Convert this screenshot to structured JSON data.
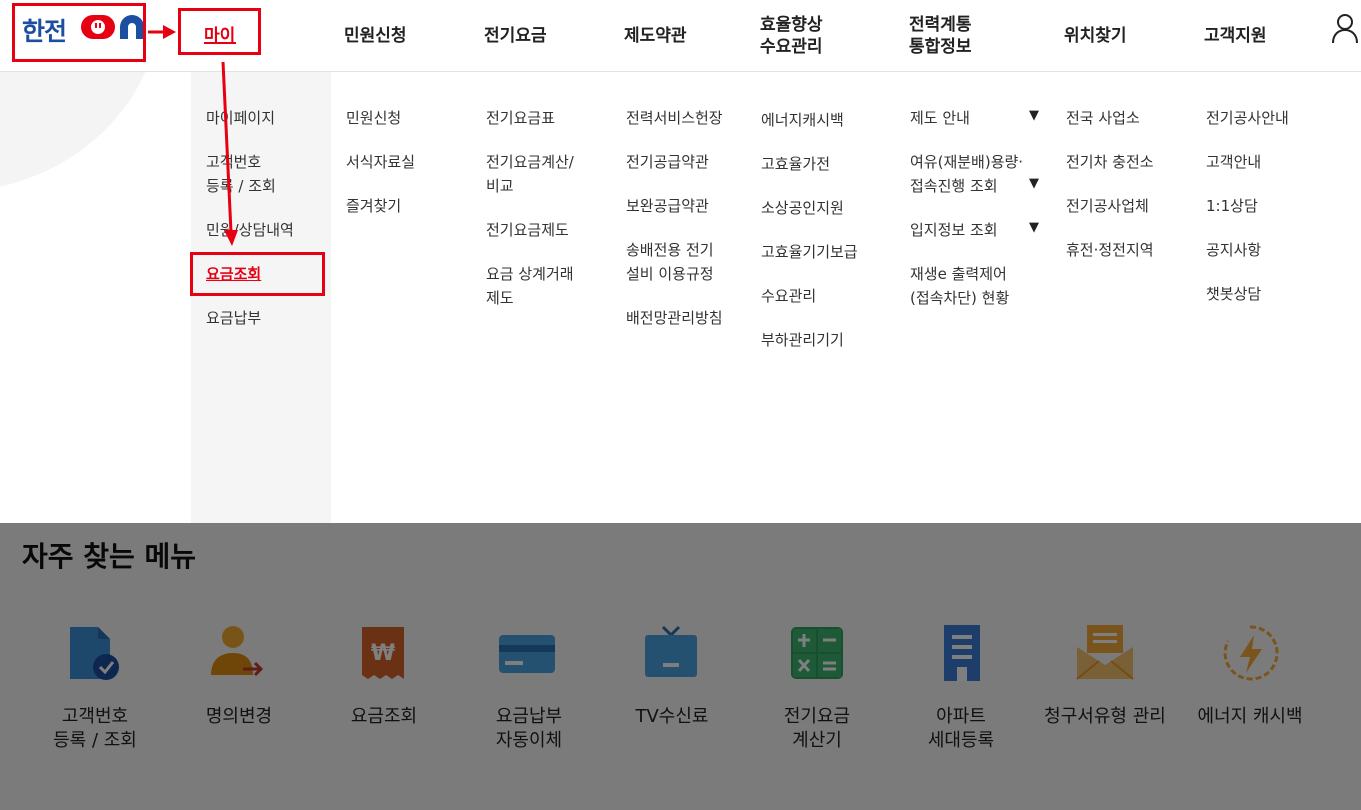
{
  "header": {
    "logo_text": "한전",
    "logo_on_text": "ON",
    "nav": {
      "mine": "마이",
      "civil": "민원신청",
      "bill": "전기요금",
      "terms": "제도약관",
      "efficiency_line1": "효율향상",
      "efficiency_line2": "수요관리",
      "grid_line1": "전력계통",
      "grid_line2": "통합정보",
      "location": "위치찾기",
      "support": "고객지원"
    }
  },
  "dropdown": {
    "mine": [
      "마이페이지",
      "고객번호",
      "등록 / 조회",
      "민원/상담내역",
      "요금조회",
      "요금납부"
    ],
    "civil": [
      "민원신청",
      "서식자료실",
      "즐겨찾기"
    ],
    "bill": [
      "전기요금표",
      "전기요금계산/",
      "비교",
      "전기요금제도",
      "요금 상계거래",
      "제도"
    ],
    "terms": [
      "전력서비스헌장",
      "전기공급약관",
      "보완공급약관",
      "송배전용 전기",
      "설비 이용규정",
      "배전망관리방침"
    ],
    "efficiency": [
      "에너지캐시백",
      "고효율가전",
      "소상공인지원",
      "고효율기기보급",
      "수요관리",
      "부하관리기기"
    ],
    "grid": [
      "제도 안내",
      "여유(재분배)용량·",
      "접속진행 조회",
      "입지정보 조회",
      "재생e 출력제어",
      "(접속차단) 현황"
    ],
    "grid_arrow": "▼",
    "location": [
      "전국 사업소",
      "전기차 충전소",
      "전기공사업체",
      "휴전·정전지역"
    ],
    "support": [
      "전기공사안내",
      "고객안내",
      "1:1상담",
      "공지사항",
      "챗봇상담"
    ]
  },
  "frequent": {
    "title": "자주 찾는 메뉴",
    "items": [
      {
        "line1": "고객번호",
        "line2": "등록 / 조회",
        "icon": "document-check-icon"
      },
      {
        "line1": "명의변경",
        "line2": "",
        "icon": "person-transfer-icon"
      },
      {
        "line1": "요금조회",
        "line2": "",
        "icon": "won-receipt-icon"
      },
      {
        "line1": "요금납부",
        "line2": "자동이체",
        "icon": "credit-card-icon"
      },
      {
        "line1": "TV수신료",
        "line2": "",
        "icon": "tv-icon"
      },
      {
        "line1": "전기요금",
        "line2": "계산기",
        "icon": "calculator-icon"
      },
      {
        "line1": "아파트",
        "line2": "세대등록",
        "icon": "apartment-icon"
      },
      {
        "line1": "청구서유형 관리",
        "line2": "",
        "icon": "mail-icon"
      },
      {
        "line1": "에너지 캐시백",
        "line2": "",
        "icon": "energy-icon"
      }
    ]
  },
  "colors": {
    "accent": "#e60012",
    "brand_blue": "#1c4fa1",
    "annotation": "#e60012"
  }
}
